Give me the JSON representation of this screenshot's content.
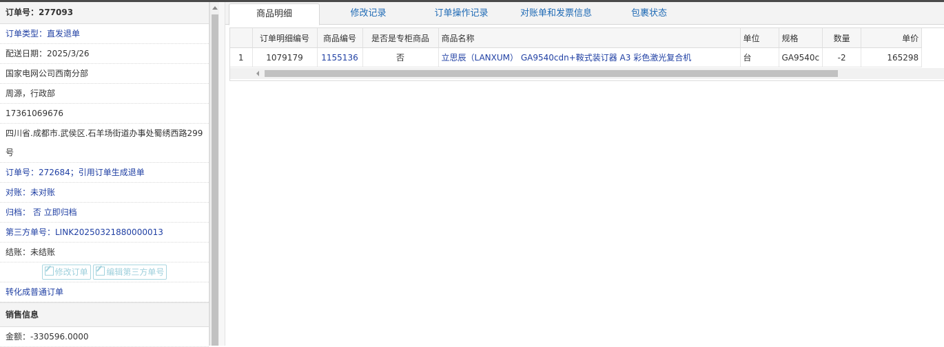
{
  "left": {
    "order_no": "订单号：277093",
    "order_type": "订单类型：直发退单",
    "delivery_date": "配送日期：2025/3/26",
    "company": "国家电网公司西南分部",
    "contact": "周源，行政部",
    "phone": "17361069676",
    "address": "四川省.成都市.武侯区.石羊场街道办事处蜀绣西路299号",
    "ref_order": "订单号：272684；引用订单生成退单",
    "reconcile": "对账：未对账",
    "archive": "归档： 否 立即归档",
    "third_party": "第三方单号：LINK20250321880000013",
    "settle": "结账：未结账",
    "edit_order_btn": "修改订单",
    "edit_third_btn": "编辑第三方单号",
    "convert_link": "转化成普通订单",
    "sales_header": "销售信息",
    "amount": "金额：-330596.0000"
  },
  "tabs": [
    "商品明细",
    "修改记录",
    "订单操作记录",
    "对账单和发票信息",
    "包裹状态"
  ],
  "grid": {
    "columns": [
      "",
      "订单明细编号",
      "商品编号",
      "是否是专柜商品",
      "商品名称",
      "单位",
      "规格",
      "数量",
      "单价"
    ],
    "rows": [
      [
        "1",
        "1079179",
        "1155136",
        "否",
        "立思辰（LANXUM） GA9540cdn+鞍式装订器 A3 彩色激光复合机",
        "台",
        "GA9540c",
        "-2",
        "165298"
      ]
    ]
  },
  "colors": {
    "link": "#1f3fa3",
    "tab_link": "#1e6ab5"
  }
}
